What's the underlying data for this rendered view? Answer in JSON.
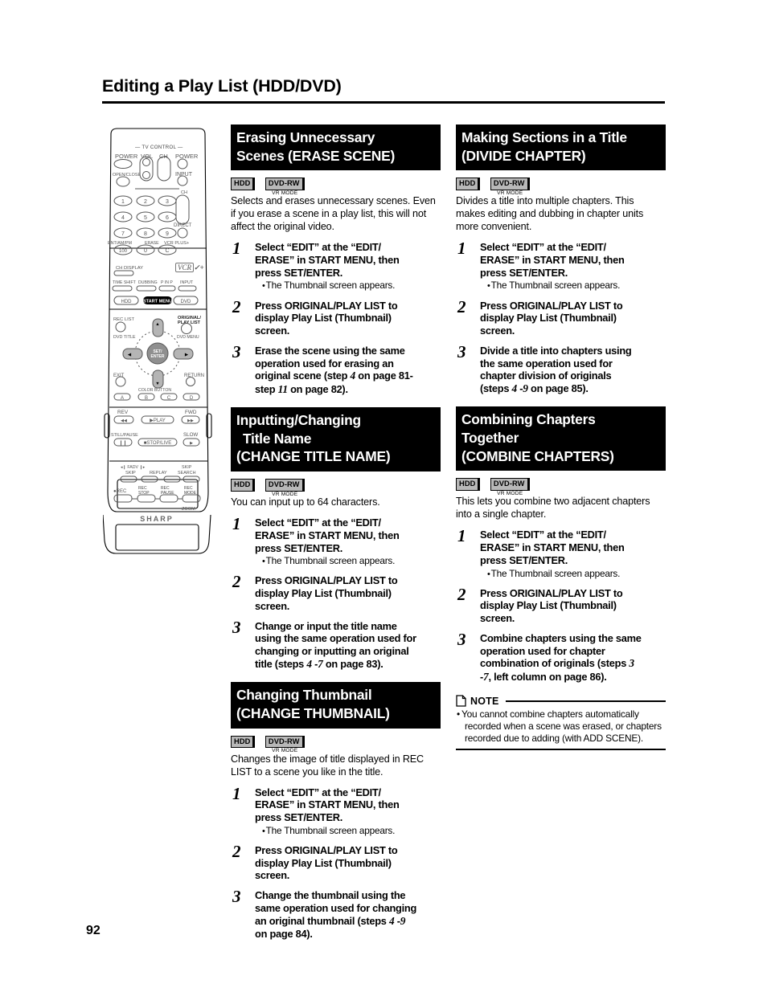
{
  "page": {
    "title": "Editing a Play List (HDD/DVD)",
    "number": "92"
  },
  "badges": {
    "hdd": "HDD",
    "dvdrw": "DVD-RW",
    "dvdrw_sub": "VR MODE"
  },
  "common_steps": {
    "step1_text": "Select “EDIT” at the “EDIT/ERASE” in START MENU, then press SET/ENTER.",
    "step1_note": "The Thumbnail screen appears.",
    "step2_text": "Press ORIGINAL/PLAY LIST to display Play List (Thumbnail) screen."
  },
  "sections": [
    {
      "id": "erase-scene",
      "column": "left",
      "heading_lines": [
        "Erasing Unnecessary",
        "Scenes (ERASE SCENE)"
      ],
      "intro": "Selects and erases unnecessary scenes. Even if you erase a scene in a play list, this will not affect the original video.",
      "steps": [
        {
          "num": "1",
          "lines": [
            "Select “EDIT” at the “EDIT/",
            "ERASE” in START MENU, then",
            "press SET/ENTER."
          ],
          "note": "The Thumbnail screen appears."
        },
        {
          "num": "2",
          "lines": [
            "Press ORIGINAL/PLAY LIST to",
            "display Play List (Thumbnail)",
            "screen."
          ],
          "note": ""
        },
        {
          "num": "3",
          "lines": [
            "Erase the scene using the same",
            "operation used for erasing an",
            "original scene (step 4 on page 81-",
            "step 11 on page 82)."
          ],
          "note": ""
        }
      ]
    },
    {
      "id": "change-title-name",
      "column": "left",
      "heading_lines": [
        "Inputting/Changing",
        "Title Name",
        "(CHANGE TITLE NAME)"
      ],
      "intro": "You can input up to 64 characters.",
      "steps": [
        {
          "num": "1",
          "lines": [
            "Select “EDIT” at the “EDIT/",
            "ERASE” in START MENU, then",
            "press SET/ENTER."
          ],
          "note": "The Thumbnail screen appears."
        },
        {
          "num": "2",
          "lines": [
            "Press ORIGINAL/PLAY LIST to",
            "display Play List (Thumbnail)",
            "screen."
          ],
          "note": ""
        },
        {
          "num": "3",
          "lines": [
            "Change or input the title name",
            "using the same operation used for",
            "changing or inputting an original",
            "title (steps 4 -7 on page 83)."
          ],
          "note": ""
        }
      ]
    },
    {
      "id": "change-thumbnail",
      "column": "left",
      "heading_lines": [
        "Changing Thumbnail",
        "(CHANGE THUMBNAIL)"
      ],
      "intro": "Changes the image of title displayed in REC LIST to a scene you like in the title.",
      "steps": [
        {
          "num": "1",
          "lines": [
            "Select “EDIT” at the “EDIT/",
            "ERASE” in START MENU, then",
            "press SET/ENTER."
          ],
          "note": "The Thumbnail screen appears."
        },
        {
          "num": "2",
          "lines": [
            "Press ORIGINAL/PLAY LIST to",
            "display Play List (Thumbnail)",
            "screen."
          ],
          "note": ""
        },
        {
          "num": "3",
          "lines": [
            "Change the thumbnail using the",
            "same operation used for changing",
            "an original thumbnail (steps 4 -9",
            "on page 84)."
          ],
          "note": ""
        }
      ]
    },
    {
      "id": "divide-chapter",
      "column": "right",
      "heading_lines": [
        "Making Sections in a Title",
        "(DIVIDE CHAPTER)"
      ],
      "intro": "Divides a title into multiple chapters. This makes editing and dubbing in chapter units more convenient.",
      "steps": [
        {
          "num": "1",
          "lines": [
            "Select “EDIT” at the “EDIT/",
            "ERASE” in START MENU, then",
            "press SET/ENTER."
          ],
          "note": "The Thumbnail screen appears."
        },
        {
          "num": "2",
          "lines": [
            "Press ORIGINAL/PLAY LIST to",
            "display Play List (Thumbnail)",
            "screen."
          ],
          "note": ""
        },
        {
          "num": "3",
          "lines": [
            "Divide a title into chapters using",
            "the same operation used for",
            "chapter division of originals",
            "(steps 4 -9 on page 85)."
          ],
          "note": ""
        }
      ]
    },
    {
      "id": "combine-chapters",
      "column": "right",
      "heading_lines": [
        "Combining Chapters",
        "Together",
        "(COMBINE CHAPTERS)"
      ],
      "intro": "This lets you combine two adjacent chapters into a single chapter.",
      "steps": [
        {
          "num": "1",
          "lines": [
            "Select “EDIT” at the “EDIT/",
            "ERASE” in START MENU, then",
            "press SET/ENTER."
          ],
          "note": "The Thumbnail screen appears."
        },
        {
          "num": "2",
          "lines": [
            "Press ORIGINAL/PLAY LIST to",
            "display Play List (Thumbnail)",
            "screen."
          ],
          "note": ""
        },
        {
          "num": "3",
          "lines": [
            "Combine chapters using the same",
            "operation used for chapter",
            "combination of originals (steps 3",
            "-7, left column on page 86)."
          ],
          "note": ""
        }
      ]
    }
  ],
  "note_box": {
    "label": "NOTE",
    "items": [
      "You cannot combine chapters automatically recorded when a scene was erased, or chapters recorded due to adding (with ADD SCENE)."
    ]
  },
  "remote": {
    "brand": "SHARP",
    "logo": "VCR Plus+",
    "labels": {
      "tv_control": "— TV CONTROL —",
      "power": "POWER",
      "vol": "VOL",
      "ch": "CH",
      "tv_power": "POWER",
      "open_close": "OPEN/CLOSE",
      "input": "INPUT",
      "ch2": "CH",
      "direct": "DIRECT",
      "ent_ampm": "ENT/AM/PM",
      "erase": "ERASE",
      "vcr_plus": "VCR PLUS+",
      "ch_display": "CH DISPLAY",
      "time_shift": "TIME SHIFT",
      "dubbing": "DUBBING",
      "p_in_p": "P IN P",
      "input2": "INPUT",
      "hdd": "HDD",
      "start_menu": "START MENU",
      "dvd": "DVD",
      "rec_list": "REC LIST",
      "dvd_title": "DVD TITLE",
      "original_play_list": "ORIGINAL/ PLAY LIST",
      "dvd_menu": "DVD MENU",
      "set_enter": "SET/ ENTER",
      "exit": "EXIT",
      "return": "RETURN",
      "color_button": "COLOR BUTTON",
      "a": "A",
      "b": "B",
      "c": "C",
      "d": "D",
      "rev": "REV",
      "fwd": "FWD",
      "play": "PLAY",
      "still_pause": "STILL/PAUSE",
      "slow": "SLOW",
      "stop_live": "STOP/LIVE",
      "fadv": "FADV",
      "skip": "SKIP",
      "replay": "REPLAY",
      "skip_search": "SKIP SEARCH",
      "rec": "REC",
      "rec_stop": "REC STOP",
      "rec_pause": "REC PAUSE",
      "rec_mode": "REC MODE",
      "zoom": "ZOOM"
    },
    "keypad": [
      "1",
      "2",
      "3",
      "4",
      "5",
      "6",
      "7",
      "8",
      "9",
      "100",
      "0",
      "C"
    ]
  }
}
